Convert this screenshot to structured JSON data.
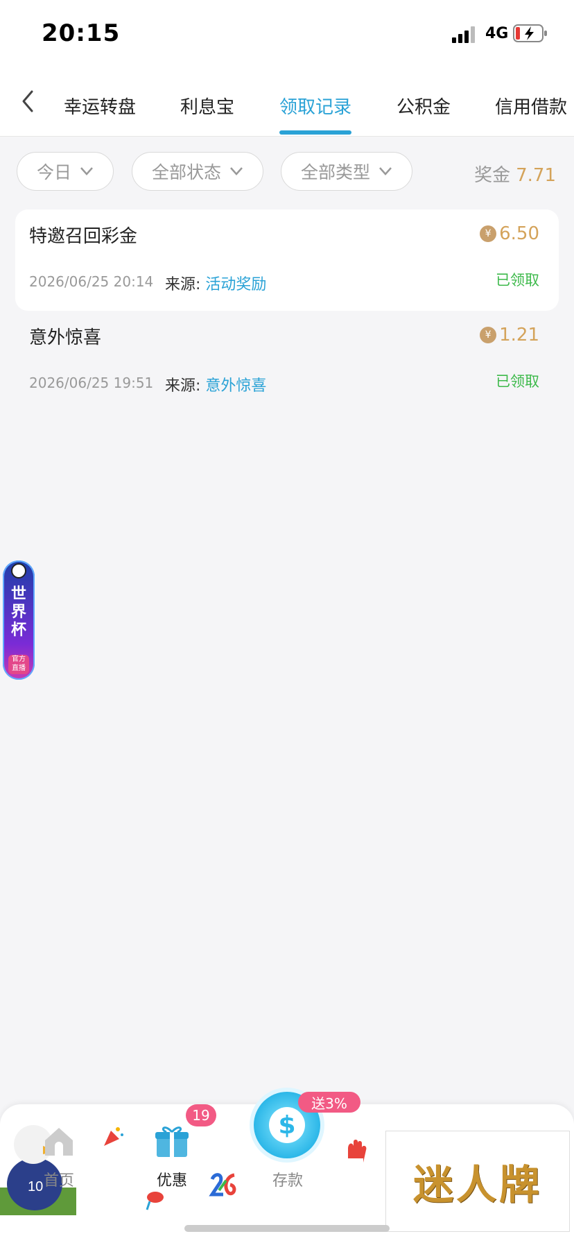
{
  "status_bar": {
    "time": "20:15",
    "network": "4G"
  },
  "header": {
    "tabs": [
      {
        "label": "幸运转盘"
      },
      {
        "label": "利息宝"
      },
      {
        "label": "领取记录"
      },
      {
        "label": "公积金"
      },
      {
        "label": "信用借款"
      }
    ],
    "active_tab": "领取记录"
  },
  "filters": {
    "date": "今日",
    "status": "全部状态",
    "type": "全部类型",
    "bonus_label": "奖金",
    "bonus_value": "7.71"
  },
  "records": [
    {
      "title": "特邀召回彩金",
      "amount": "6.50",
      "date": "2026/06/25 20:14",
      "source_label": "来源:",
      "source_value": "活动奖励",
      "status": "已领取"
    },
    {
      "title": "意外惊喜",
      "amount": "1.21",
      "date": "2026/06/25 19:51",
      "source_label": "来源:",
      "source_value": "意外惊喜",
      "status": "已领取"
    }
  ],
  "float_banner": {
    "title": "世界杯",
    "subtitle": "官方直播"
  },
  "bottom_nav": {
    "home": "首页",
    "promotions": "优惠",
    "promotions_badge": "19",
    "deposit": "存款",
    "deposit_promo": "送3%",
    "brand": "迷人牌"
  },
  "colors": {
    "accent": "#2aa2d6",
    "gold": "#d4a35a",
    "claimed": "#3cb94a",
    "badge": "#f25a84"
  }
}
